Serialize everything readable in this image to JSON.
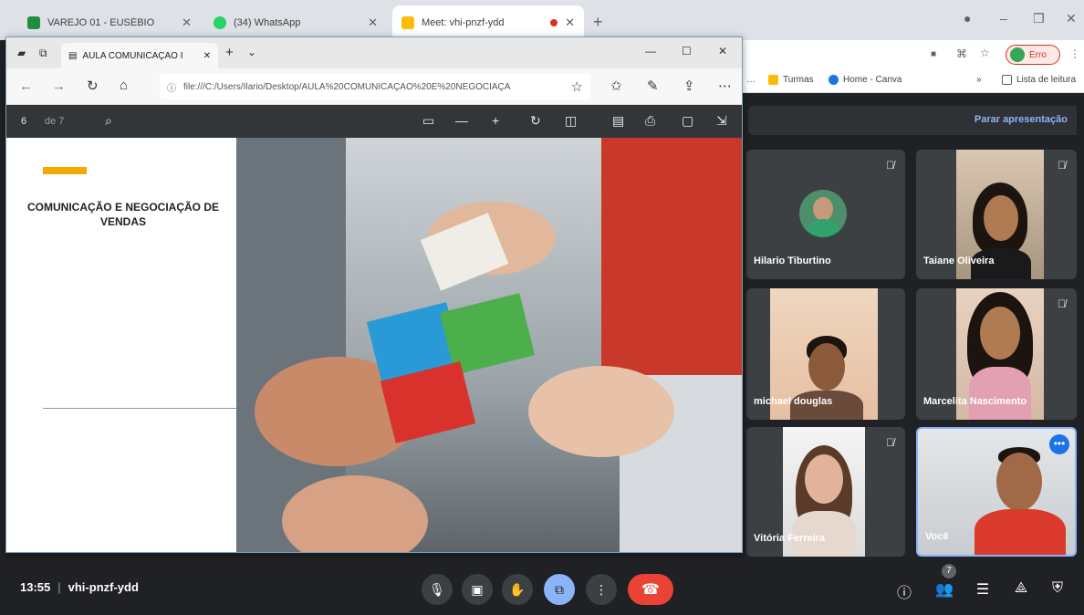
{
  "browser": {
    "tabs": [
      {
        "title": "VAREJO 01 - EUSÉBIO",
        "color": "#1e8e3e"
      },
      {
        "title": "(34) WhatsApp",
        "color": "#25d366"
      },
      {
        "title": "Meet: vhi-pnzf-ydd",
        "color": "#fbbc04"
      }
    ],
    "profile_label": "Erro",
    "bookmarks": [
      {
        "label": "Turmas",
        "color": "#fbbc04"
      },
      {
        "label": "Home - Canva",
        "color": "#1a73e8"
      }
    ],
    "more_bookmarks": "»",
    "reading_list": "Lista de leitura"
  },
  "edge": {
    "tab_title": "AULA COMUNICAÇÃO I",
    "address": "file:///C:/Users/Ilario/Desktop/AULA%20COMUNICAÇÃO%20E%20NEGOCIAÇÃ"
  },
  "pdf": {
    "page": "6",
    "total": "de 7",
    "slide_title": "COMUNICAÇÃO E NEGOCIAÇÃO DE VENDAS"
  },
  "meet": {
    "stop_presenting": "Parar apresentação",
    "participants": [
      {
        "name": "Hilario Tiburtino",
        "muted": true,
        "camera": false
      },
      {
        "name": "Taiane Oliveira",
        "muted": true,
        "camera": true
      },
      {
        "name": "michael douglas",
        "muted": false,
        "camera": true
      },
      {
        "name": "Marcelita Nascimento",
        "muted": true,
        "camera": true
      },
      {
        "name": "Vitória Ferreira",
        "muted": true,
        "camera": true
      },
      {
        "name": "Você",
        "muted": false,
        "camera": true
      }
    ],
    "time": "13:55",
    "meeting_code": "vhi-pnzf-ydd",
    "participant_count": "7",
    "colors": {
      "hangup": "#ea4335",
      "present_active": "#8ab4f8",
      "self_border": "#8ab4f8"
    }
  }
}
